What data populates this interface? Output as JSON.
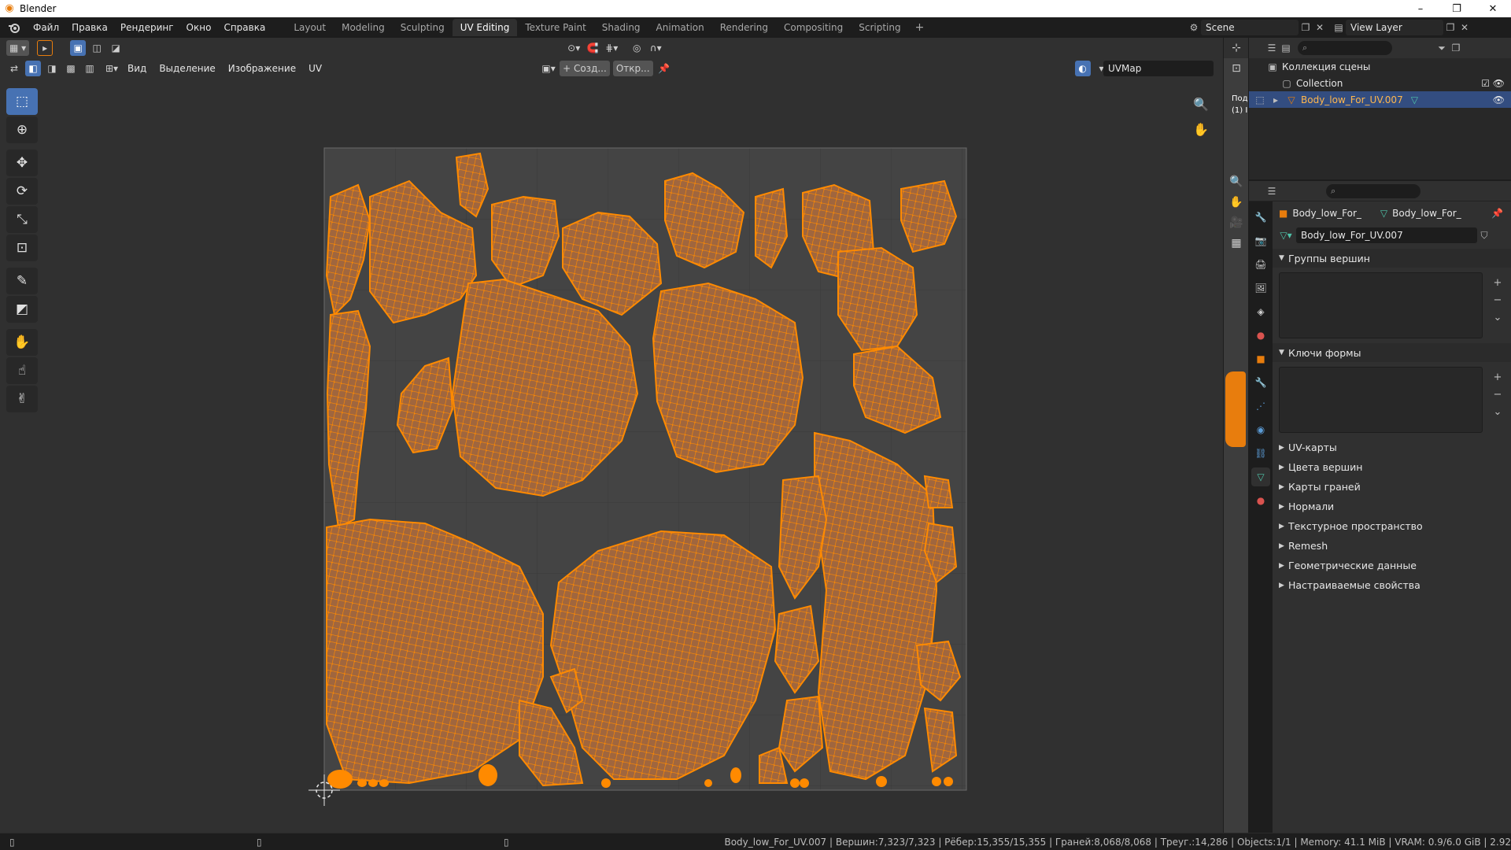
{
  "window": {
    "title": "Blender",
    "controls": [
      "–",
      "❐",
      "✕"
    ]
  },
  "menu": [
    "Файл",
    "Правка",
    "Рендеринг",
    "Окно",
    "Справка"
  ],
  "workspaces": [
    {
      "label": "Layout",
      "active": false
    },
    {
      "label": "Modeling",
      "active": false
    },
    {
      "label": "Sculpting",
      "active": false
    },
    {
      "label": "UV Editing",
      "active": true
    },
    {
      "label": "Texture Paint",
      "active": false
    },
    {
      "label": "Shading",
      "active": false
    },
    {
      "label": "Animation",
      "active": false
    },
    {
      "label": "Rendering",
      "active": false
    },
    {
      "label": "Compositing",
      "active": false
    },
    {
      "label": "Scripting",
      "active": false
    }
  ],
  "scene": {
    "name": "Scene",
    "view_layer": "View Layer"
  },
  "uv_editor": {
    "menus": [
      "Вид",
      "Выделение",
      "Изображение",
      "UV"
    ],
    "new_image": "+ Созд...",
    "open_image": "Откр...",
    "uvmap": "UVMap",
    "accent": "#e87d0d"
  },
  "view3d": {
    "label_line1": "Под",
    "label_line2": "(1) I"
  },
  "outliner": {
    "rows": [
      {
        "label": "Коллекция сцены",
        "selected": false
      },
      {
        "label": "Collection",
        "selected": false
      },
      {
        "label": "Body_low_For_UV.007",
        "selected": true
      }
    ]
  },
  "properties": {
    "context_object": "Body_low_For_",
    "context_mesh": "Body_low_For_",
    "mesh_name": "Body_low_For_UV.007",
    "panels_open": [
      "Группы вершин",
      "Ключи формы"
    ],
    "panels_closed": [
      "UV-карты",
      "Цвета вершин",
      "Карты граней",
      "Нормали",
      "Текстурное пространство",
      "Remesh",
      "Геометрические данные",
      "Настраиваемые свойства"
    ]
  },
  "statusbar": {
    "stats": "Body_low_For_UV.007 | Вершин:7,323/7,323 | Рёбер:15,355/15,355 | Граней:8,068/8,068 | Треуг.:14,286 | Objects:1/1 | Memory: 41.1 MiB | VRAM: 0.9/6.0 GiB | 2.92"
  }
}
